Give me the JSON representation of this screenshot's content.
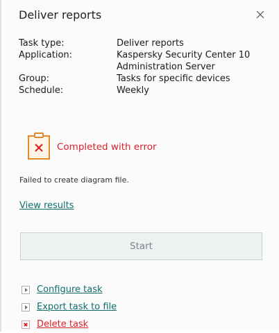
{
  "panel": {
    "title": "Deliver reports",
    "close_label": "×"
  },
  "properties": [
    {
      "key": "Task type:",
      "value": "Deliver reports"
    },
    {
      "key": "Application:",
      "value": "Kaspersky Security Center 10 Administration Server"
    },
    {
      "key": "Group:",
      "value": "Tasks for specific devices"
    },
    {
      "key": "Schedule:",
      "value": "Weekly"
    }
  ],
  "status": {
    "icon": "clipboard-error-icon",
    "text": "Completed with error",
    "message": "Failed to create diagram file."
  },
  "links": {
    "view_results": "View results"
  },
  "start_button": {
    "label": "Start",
    "state": "disabled"
  },
  "actions": [
    {
      "label": "Configure task",
      "icon": "arrow-right-icon"
    },
    {
      "label": "Export task to file",
      "icon": "arrow-right-icon"
    },
    {
      "label": "Delete task",
      "icon": "delete-x-icon"
    }
  ],
  "colors": {
    "link": "#0f6f6a",
    "error": "#d8222b",
    "status_icon_outline": "#e08a2a"
  }
}
